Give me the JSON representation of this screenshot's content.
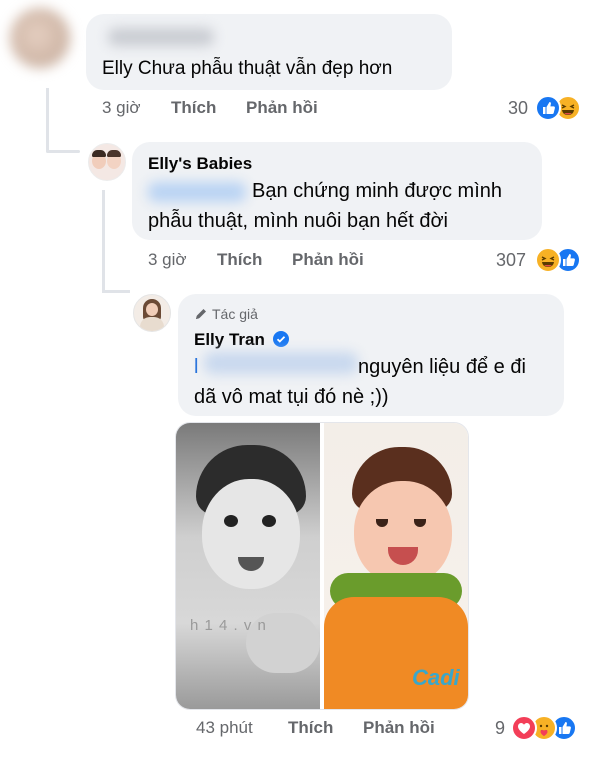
{
  "comment1": {
    "text": "Elly Chưa phẫu thuật vẫn đẹp hơn",
    "time": "3 giờ",
    "like_label": "Thích",
    "reply_label": "Phản hồi",
    "reaction_count": "30",
    "reactions": [
      "like-icon",
      "haha-icon"
    ]
  },
  "comment2": {
    "author": "Elly's Babies",
    "text_line1": "Bạn chứng minh được mình",
    "text_line2": "phẫu thuật, mình nuôi bạn hết đời",
    "time": "3 giờ",
    "like_label": "Thích",
    "reply_label": "Phản hồi",
    "reaction_count": "307",
    "reactions": [
      "haha-icon",
      "like-icon"
    ]
  },
  "comment3": {
    "badge": "Tác giả",
    "author": "Elly Tran",
    "text_line1_prefix": "l",
    "text_line1": "nguyên liệu để e đi",
    "text_line2": "dã vô mat tụi đó nè ;))",
    "watermark": "h 1 4 . v n",
    "photo_logo": "Cadi",
    "time": "43 phút",
    "like_label": "Thích",
    "reply_label": "Phản hồi",
    "reaction_count": "9",
    "reactions": [
      "love-icon",
      "care-icon",
      "like-icon"
    ]
  },
  "colors": {
    "bubble": "#f0f2f5",
    "meta_text": "#65676b",
    "link_blue": "#216fdb",
    "like_blue": "#1877f2",
    "haha_yellow": "#f7b125",
    "love_red": "#f33e58",
    "verified_blue": "#1877f2"
  }
}
